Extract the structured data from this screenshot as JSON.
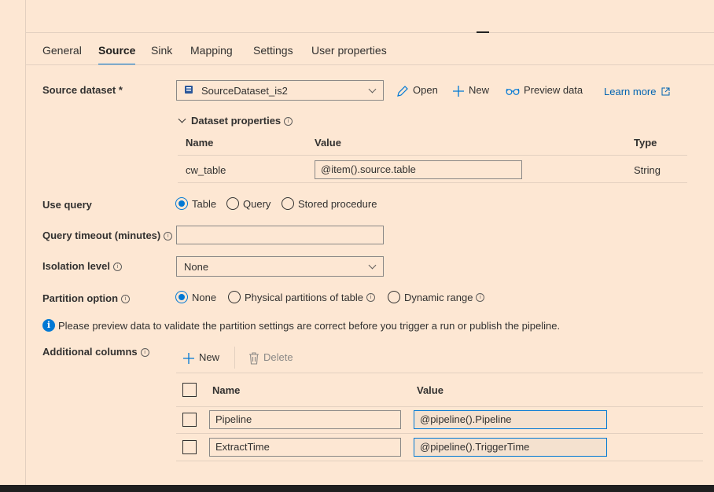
{
  "tabs": [
    "General",
    "Source",
    "Sink",
    "Mapping",
    "Settings",
    "User properties"
  ],
  "source_dataset": {
    "label": "Source dataset *",
    "value": "SourceDataset_is2",
    "open": "Open",
    "new": "New",
    "preview": "Preview data",
    "learn_more": "Learn more"
  },
  "dataset_properties": {
    "toggle": "Dataset properties",
    "headers": {
      "name": "Name",
      "value": "Value",
      "type": "Type"
    },
    "rows": [
      {
        "name": "cw_table",
        "value": "@item().source.table",
        "type": "String"
      }
    ]
  },
  "use_query": {
    "label": "Use query",
    "options": [
      "Table",
      "Query",
      "Stored procedure"
    ],
    "selected": "Table"
  },
  "query_timeout": {
    "label": "Query timeout (minutes)",
    "value": ""
  },
  "isolation_level": {
    "label": "Isolation level",
    "value": "None"
  },
  "partition_option": {
    "label": "Partition option",
    "options": [
      "None",
      "Physical partitions of table",
      "Dynamic range"
    ],
    "selected": "None"
  },
  "notice": "Please preview data to validate the partition settings are correct before you trigger a run or publish the pipeline.",
  "additional_columns": {
    "label": "Additional columns",
    "new": "New",
    "delete": "Delete",
    "headers": {
      "name": "Name",
      "value": "Value"
    },
    "rows": [
      {
        "name": "Pipeline",
        "value": "@pipeline().Pipeline"
      },
      {
        "name": "ExtractTime",
        "value": "@pipeline().TriggerTime"
      }
    ]
  },
  "colors": {
    "accent": "#0078d4",
    "background": "#fde7d3",
    "link": "#0063b1"
  }
}
